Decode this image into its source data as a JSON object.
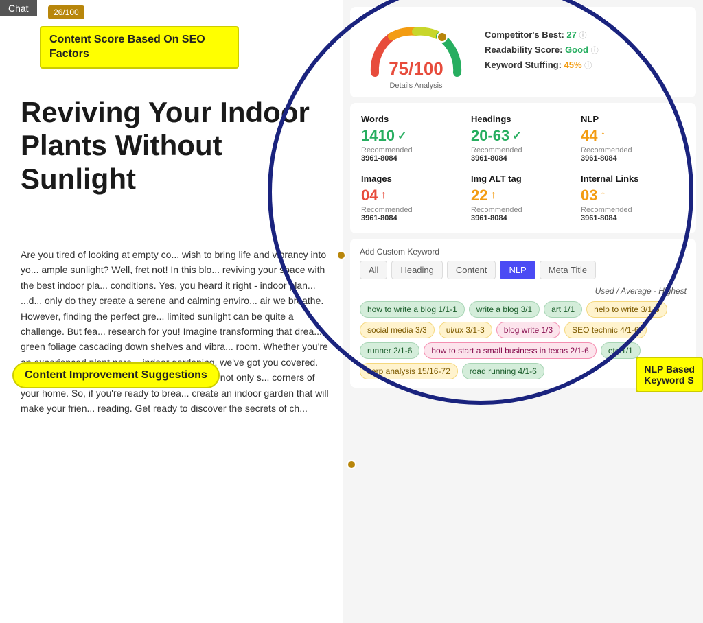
{
  "chat_tab": "Chat",
  "score_badge": "26/100",
  "content_score_label": "Content Score Based On SEO Factors",
  "blog_title": "Reviving Your Indoor Plants Without Sunlight",
  "blog_body_lines": [
    "Are you tired of looking at empty corners and",
    "wish to bring life and vibrancy into your home with",
    "ample sunlight? Well, fret not! In this blog about",
    "reviving your space with the best indoor pla...",
    "conditions. Yes, you heard it right - indoor plan..."
  ],
  "content_improvement_label": "Content Improvement Suggestions",
  "gauge": {
    "score": "75",
    "max": "100",
    "details_link": "Details Analysis"
  },
  "score_details": {
    "competitor_best_label": "Competitor's Best:",
    "competitor_best_val": "27",
    "readability_label": "Readability Score:",
    "readability_val": "Good",
    "keyword_stuffing_label": "Keyword Stuffing:",
    "keyword_stuffing_val": "45%"
  },
  "metrics": [
    {
      "label": "Words",
      "value": "1410",
      "symbol": "✓",
      "color": "green",
      "rec_label": "Recommended",
      "rec_val": "3961-8084"
    },
    {
      "label": "Headings",
      "value": "20-63",
      "symbol": "✓",
      "color": "green",
      "rec_label": "Recommended",
      "rec_val": "3961-8084"
    },
    {
      "label": "NLP",
      "value": "44",
      "symbol": "↑",
      "color": "orange",
      "rec_label": "Recommended",
      "rec_val": "3961-8084"
    },
    {
      "label": "Images",
      "value": "04",
      "symbol": "↑",
      "color": "red",
      "rec_label": "Recommended",
      "rec_val": "3961-8084"
    },
    {
      "label": "Img ALT tag",
      "value": "22",
      "symbol": "↑",
      "color": "orange",
      "rec_label": "Recommended",
      "rec_val": "3961-8084"
    },
    {
      "label": "Internal Links",
      "value": "03",
      "symbol": "↑",
      "color": "orange",
      "rec_label": "Recommended",
      "rec_val": "3961-8084"
    }
  ],
  "keyword_filters": [
    {
      "label": "All",
      "active": false
    },
    {
      "label": "Heading",
      "active": false
    },
    {
      "label": "Content",
      "active": false
    },
    {
      "label": "NLP",
      "active": true
    },
    {
      "label": "Meta Title",
      "active": false
    }
  ],
  "used_avg_label": "Used / Average - Highest",
  "add_custom_kw": "Add Custom Keyword",
  "keyword_tags": [
    {
      "text": "how to write a blog",
      "score": "1/1-1",
      "color": "green"
    },
    {
      "text": "write a blog",
      "score": "3/1",
      "color": "green"
    },
    {
      "text": "art",
      "score": "1/1",
      "color": "green"
    },
    {
      "text": "help to write",
      "score": "3/1-6",
      "color": "orange"
    },
    {
      "text": "social media",
      "score": "3/3",
      "color": "orange"
    },
    {
      "text": "ui/ux",
      "score": "3/1-3",
      "color": "orange"
    },
    {
      "text": "blog write",
      "score": "1/3",
      "color": "pink"
    },
    {
      "text": "SEO technic",
      "score": "4/1-6",
      "color": "orange"
    },
    {
      "text": "runner",
      "score": "2/1-6",
      "color": "green"
    },
    {
      "text": "how to start a small business in texas",
      "score": "2/1-6",
      "color": "pink"
    },
    {
      "text": "etc",
      "score": "1/1",
      "color": "green"
    },
    {
      "text": "serp analysis",
      "score": "15/16-72",
      "color": "orange"
    },
    {
      "text": "road running",
      "score": "4/1-6",
      "color": "green"
    }
  ],
  "nlp_label": "NLP Based\nKeyword S"
}
